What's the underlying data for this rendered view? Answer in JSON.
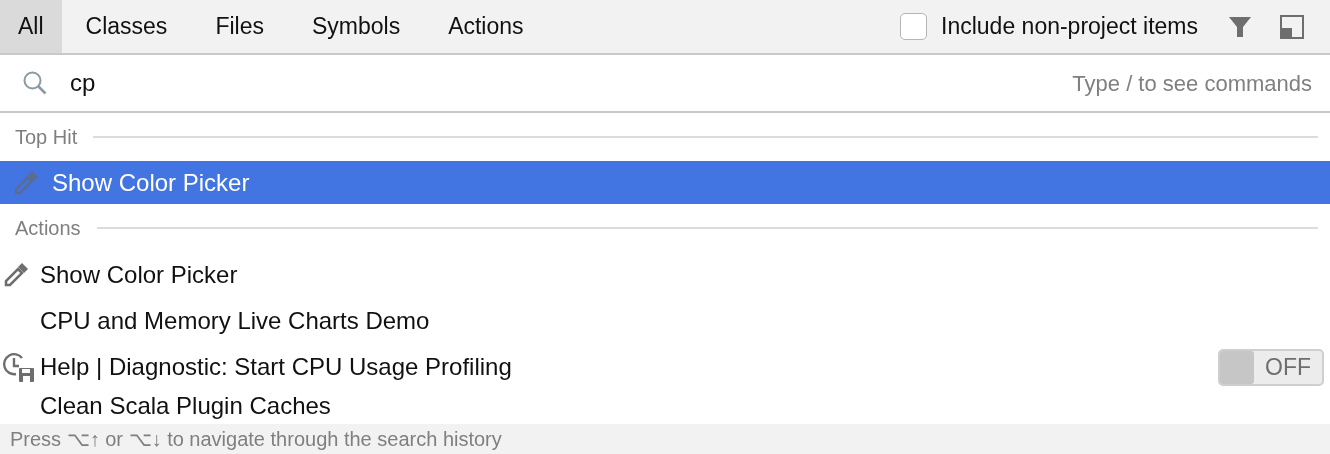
{
  "tabs": [
    {
      "label": "All",
      "selected": true
    },
    {
      "label": "Classes",
      "selected": false
    },
    {
      "label": "Files",
      "selected": false
    },
    {
      "label": "Symbols",
      "selected": false
    },
    {
      "label": "Actions",
      "selected": false
    }
  ],
  "include_non_project": {
    "label": "Include non-project items",
    "checked": false
  },
  "search": {
    "value": "cp",
    "hint": "Type / to see commands"
  },
  "sections": [
    {
      "title": "Top Hit",
      "items": [
        {
          "kind": "picker",
          "label": "Show Color Picker",
          "selected": true
        }
      ]
    },
    {
      "title": "Actions",
      "items": [
        {
          "kind": "picker",
          "label": "Show Color Picker",
          "selected": false
        },
        {
          "kind": "plain",
          "label": "CPU and Memory Live Charts Demo",
          "selected": false
        },
        {
          "kind": "profiler",
          "label": "Help | Diagnostic: Start CPU Usage Profiling",
          "selected": false,
          "toggle": {
            "on": false,
            "label": "OFF"
          }
        },
        {
          "kind": "plain",
          "label": "Clean Scala Plugin Caches",
          "selected": false
        }
      ]
    }
  ],
  "status_bar": "Press ⌥↑ or ⌥↓ to navigate through the search history"
}
